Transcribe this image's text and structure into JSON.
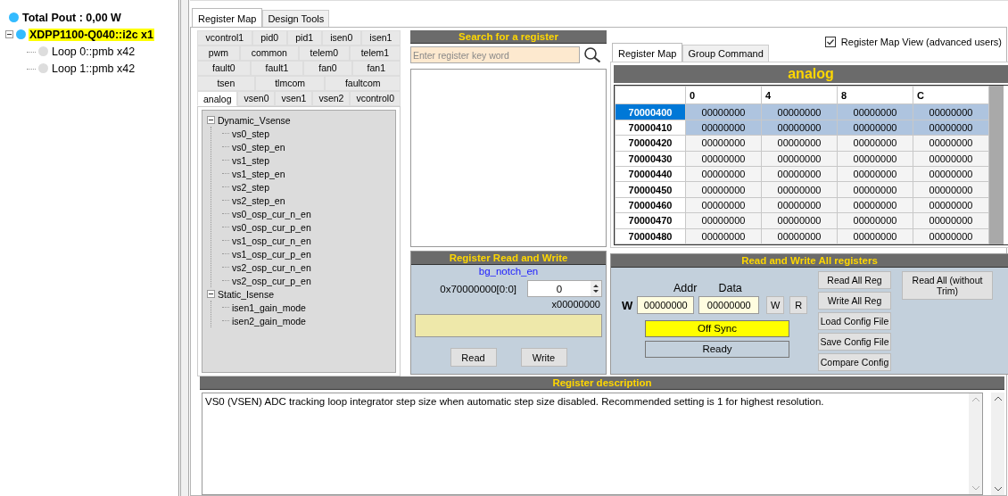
{
  "device_tree": [
    {
      "label": "Total Pout : 0,00 W",
      "color": "#33bbff",
      "selected": false
    },
    {
      "label": "XDPP1100-Q040::i2c x1",
      "color": "#33bbff",
      "selected": true,
      "expanded": true,
      "children": [
        {
          "label": "Loop 0::pmb x42",
          "color": "#dddddd",
          "selected": false
        },
        {
          "label": "Loop 1::pmb x42",
          "color": "#dddddd",
          "selected": false
        }
      ]
    }
  ],
  "main_tabs": [
    {
      "label": "Register Map",
      "selected": true
    },
    {
      "label": "Design Tools",
      "selected": false
    }
  ],
  "register_tab_rows": [
    [
      {
        "label": "vcontrol1",
        "selected": false
      },
      {
        "label": "pid0",
        "selected": false
      },
      {
        "label": "pid1",
        "selected": false
      },
      {
        "label": "isen0",
        "selected": false
      },
      {
        "label": "isen1",
        "selected": false
      }
    ],
    [
      {
        "label": "pwm",
        "selected": false
      },
      {
        "label": "common",
        "selected": false
      },
      {
        "label": "telem0",
        "selected": false
      },
      {
        "label": "telem1",
        "selected": false
      }
    ],
    [
      {
        "label": "fault0",
        "selected": false
      },
      {
        "label": "fault1",
        "selected": false
      },
      {
        "label": "fan0",
        "selected": false
      },
      {
        "label": "fan1",
        "selected": false
      }
    ],
    [
      {
        "label": "tsen",
        "selected": false
      },
      {
        "label": "tlmcom",
        "selected": false
      },
      {
        "label": "faultcom",
        "selected": false
      }
    ],
    [
      {
        "label": "analog",
        "selected": true
      },
      {
        "label": "vsen0",
        "selected": false
      },
      {
        "label": "vsen1",
        "selected": false
      },
      {
        "label": "vsen2",
        "selected": false
      },
      {
        "label": "vcontrol0",
        "selected": false
      }
    ]
  ],
  "register_tree": [
    {
      "label": "Dynamic_Vsense",
      "expanded": true,
      "children": [
        {
          "label": "vs0_step"
        },
        {
          "label": "vs0_step_en"
        },
        {
          "label": "vs1_step"
        },
        {
          "label": "vs1_step_en"
        },
        {
          "label": "vs2_step"
        },
        {
          "label": "vs2_step_en"
        },
        {
          "label": "vs0_osp_cur_n_en"
        },
        {
          "label": "vs0_osp_cur_p_en"
        },
        {
          "label": "vs1_osp_cur_n_en"
        },
        {
          "label": "vs1_osp_cur_p_en"
        },
        {
          "label": "vs2_osp_cur_n_en"
        },
        {
          "label": "vs2_osp_cur_p_en"
        }
      ]
    },
    {
      "label": "Static_Isense",
      "expanded": true,
      "children": [
        {
          "label": "isen1_gain_mode"
        },
        {
          "label": "isen2_gain_mode"
        }
      ]
    }
  ],
  "search": {
    "title": "Search for a register",
    "placeholder": "Enter register key word"
  },
  "read_write": {
    "title": "Register Read and Write",
    "register_name": "bg_notch_en",
    "address": "0x70000000[0:0]",
    "value": "0",
    "hex": "x00000000",
    "buttons": [
      "Read",
      "Write"
    ]
  },
  "advanced_view": {
    "label": "Register Map View (advanced users)",
    "checked": true
  },
  "map_tabs": [
    {
      "label": "Register Map",
      "selected": true
    },
    {
      "label": "Group Command",
      "selected": false
    }
  ],
  "register_map": {
    "title": "analog",
    "columns": [
      "0",
      "4",
      "8",
      "C"
    ],
    "rows": [
      {
        "address": "70000400",
        "values": [
          "00000000",
          "00000000",
          "00000000",
          "00000000"
        ],
        "selected": true,
        "current": true
      },
      {
        "address": "70000410",
        "values": [
          "00000000",
          "00000000",
          "00000000",
          "00000000"
        ],
        "selected": true,
        "current": false
      },
      {
        "address": "70000420",
        "values": [
          "00000000",
          "00000000",
          "00000000",
          "00000000"
        ],
        "selected": false,
        "current": false
      },
      {
        "address": "70000430",
        "values": [
          "00000000",
          "00000000",
          "00000000",
          "00000000"
        ],
        "selected": false,
        "current": false
      },
      {
        "address": "70000440",
        "values": [
          "00000000",
          "00000000",
          "00000000",
          "00000000"
        ],
        "selected": false,
        "current": false
      },
      {
        "address": "70000450",
        "values": [
          "00000000",
          "00000000",
          "00000000",
          "00000000"
        ],
        "selected": false,
        "current": false
      },
      {
        "address": "70000460",
        "values": [
          "00000000",
          "00000000",
          "00000000",
          "00000000"
        ],
        "selected": false,
        "current": false
      },
      {
        "address": "70000470",
        "values": [
          "00000000",
          "00000000",
          "00000000",
          "00000000"
        ],
        "selected": false,
        "current": false
      },
      {
        "address": "70000480",
        "values": [
          "00000000",
          "00000000",
          "00000000",
          "00000000"
        ],
        "selected": false,
        "current": false
      }
    ]
  },
  "read_write_all": {
    "title": "Read and Write All registers",
    "addr_label": "Addr",
    "data_label": "Data",
    "mode": "W",
    "addr_value": "00000000",
    "data_value": "00000000",
    "small_buttons": [
      "W",
      "R"
    ],
    "sync_status": "Off Sync",
    "synced": false,
    "status": "Ready",
    "buttons": [
      "Read All Reg",
      "Write All Reg",
      "Load Config File",
      "Save Config File",
      "Compare Config"
    ],
    "side_button": "Read All (without Trim)"
  },
  "description": {
    "title": "Register description",
    "text": "VS0 (VSEN) ADC tracking loop integrator step size when automatic step size disabled.  Recommended setting is 1 for highest resolution."
  }
}
